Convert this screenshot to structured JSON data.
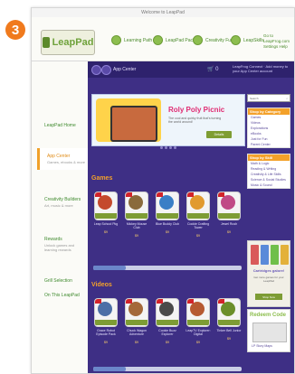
{
  "step": "3",
  "window": {
    "title": "Welcome to LeapPad"
  },
  "header": {
    "logo": "LeapPad",
    "nav": [
      "Learning Path",
      "LeapPad Pack",
      "Creativity Fun",
      "LeapSkills"
    ],
    "page_links": "Go to LeapFrog.com Settings Help"
  },
  "sidebar": {
    "items": [
      {
        "label": "LeapPad Home",
        "sub": ""
      },
      {
        "label": "App Center",
        "sub": "Games, ebooks & more"
      },
      {
        "label": "Creativity Builders",
        "sub": "Art, music & more"
      },
      {
        "label": "Rewards",
        "sub": "Unlock games and learning rewards"
      },
      {
        "label": "Grill Selection",
        "sub": ""
      },
      {
        "label": "On This LeapPad",
        "sub": ""
      }
    ]
  },
  "main": {
    "header_title": "App Center",
    "cart": "🛒 0",
    "account": "LeapFrog Connect · Add money to your App Center account",
    "banner": {
      "title": "Roly Poly Picnic",
      "desc": "The cool and quirky fruit that's turning the world around!",
      "button": "Details"
    },
    "games_title": "Games",
    "games": [
      {
        "name": "Leap School Pkg",
        "price": "$9"
      },
      {
        "name": "Mickey Mouse Club",
        "price": "$9"
      },
      {
        "name": "Blue Buddy Club",
        "price": "$9"
      },
      {
        "name": "Cookie Crafting Tower",
        "price": "$9"
      },
      {
        "name": "Jewel Rush",
        "price": "$9"
      }
    ],
    "games_progress": 0.22,
    "videos_title": "Videos",
    "videos": [
      {
        "name": "Grace Robot Episode Pack",
        "price": "$9"
      },
      {
        "name": "Chuck Wagon Adventure",
        "price": "$9"
      },
      {
        "name": "Cookie Buzz Explorer",
        "price": "$9"
      },
      {
        "name": "LeapTV Explorer: Digital",
        "price": "$9"
      },
      {
        "name": "Tinker Bell Junior",
        "price": "$9"
      }
    ],
    "videos_progress": 0.22
  },
  "right": {
    "search_placeholder": "Search",
    "box1_title": "Shop by Category",
    "box1_items": [
      "Games",
      "Videos",
      "Explorations",
      "eBooks",
      "Just for Fun",
      "Parent Center"
    ],
    "box2_title": "Shop by Skill",
    "box2_items": [
      "Math & Logic",
      "Reading & Writing",
      "Creativity & Life Skills",
      "Science & Social Studies",
      "Music & Sound"
    ],
    "promo_title": "Cartridges galore!",
    "promo_desc": "Get more games for your LeapPad",
    "promo_button": "Shop Now",
    "promo2_title": "Redeem Code",
    "promo2_link": "LP Story Maps"
  },
  "colors": {
    "accent": "#f07a1d",
    "brand_green": "#7d9c34",
    "main_bg": "#3e2f85",
    "section_title": "#f3a12a"
  }
}
